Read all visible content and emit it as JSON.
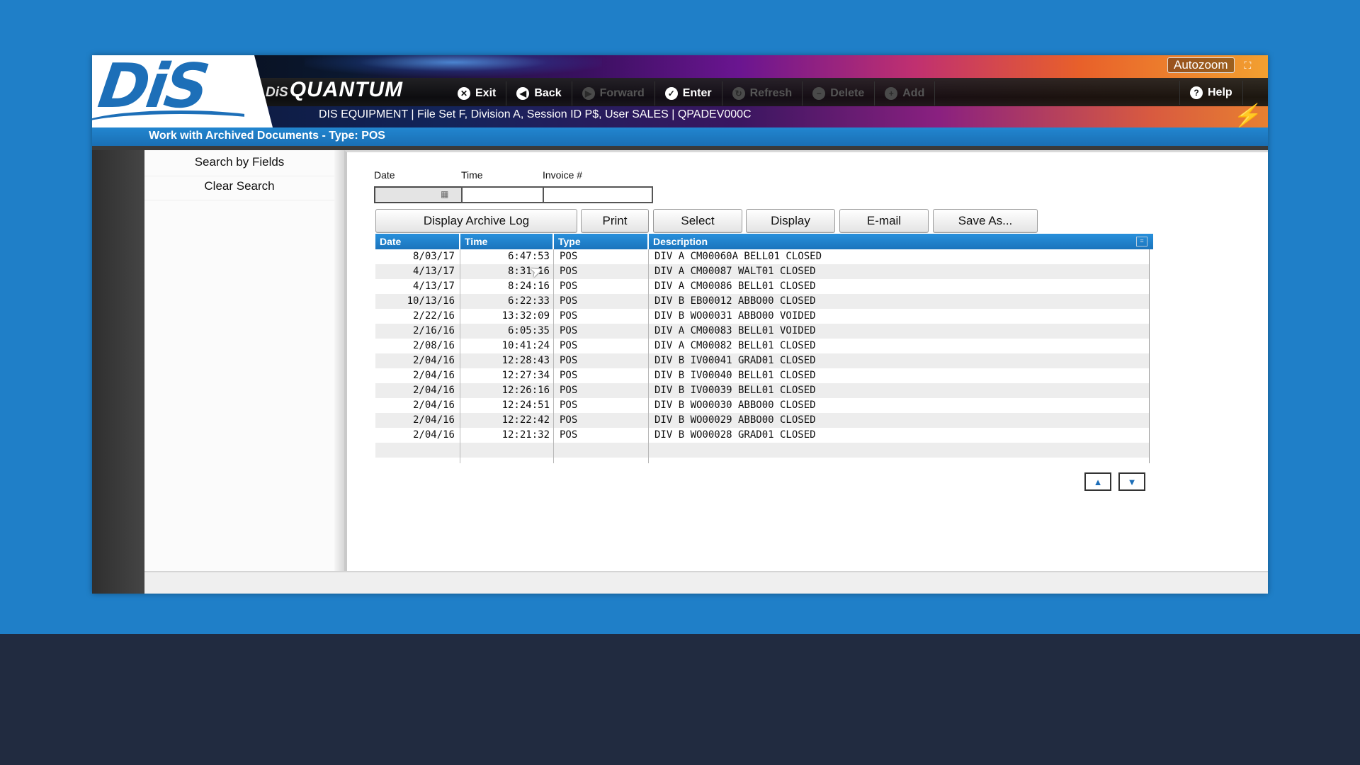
{
  "header": {
    "logo_text": "DiS",
    "brand_small": "DiS",
    "brand_big": "QUANTUM",
    "session_line": "DIS EQUIPMENT | File Set F, Division A, Session ID P$, User SALES | QPADEV000C",
    "autozoom_label": "Autozoom",
    "toolbar": [
      {
        "label": "Exit",
        "icon": "x-circle",
        "glyph": "✕",
        "enabled": true
      },
      {
        "label": "Back",
        "icon": "arrow-left-circle",
        "glyph": "◀",
        "enabled": true
      },
      {
        "label": "Forward",
        "icon": "arrow-right-circle",
        "glyph": "▶",
        "enabled": false
      },
      {
        "label": "Enter",
        "icon": "check-circle",
        "glyph": "✓",
        "enabled": true
      },
      {
        "label": "Refresh",
        "icon": "refresh-circle",
        "glyph": "↻",
        "enabled": false
      },
      {
        "label": "Delete",
        "icon": "minus-circle",
        "glyph": "−",
        "enabled": false
      },
      {
        "label": "Add",
        "icon": "plus-circle",
        "glyph": "+",
        "enabled": false
      }
    ],
    "help_label": "Help"
  },
  "subtitle": "Work with Archived Documents - Type: POS",
  "sidebar": {
    "items": [
      {
        "label": "Search by Fields"
      },
      {
        "label": "Clear Search"
      }
    ]
  },
  "search": {
    "date_label": "Date",
    "time_label": "Time",
    "invoice_label": "Invoice #",
    "date_value": "",
    "time_value": "",
    "invoice_value": ""
  },
  "actions": {
    "display_archive_log": "Display Archive Log",
    "print": "Print",
    "select": "Select",
    "display": "Display",
    "email": "E-mail",
    "save_as": "Save As..."
  },
  "grid": {
    "columns": [
      "Date",
      "Time",
      "Type",
      "Description"
    ],
    "rows": [
      {
        "date": "8/03/17",
        "time": "6:47:53",
        "type": "POS",
        "description": "DIV A CM00060A BELL01 CLOSED"
      },
      {
        "date": "4/13/17",
        "time": "8:31:16",
        "type": "POS",
        "description": "DIV A CM00087 WALT01 CLOSED"
      },
      {
        "date": "4/13/17",
        "time": "8:24:16",
        "type": "POS",
        "description": "DIV A CM00086 BELL01 CLOSED"
      },
      {
        "date": "10/13/16",
        "time": "6:22:33",
        "type": "POS",
        "description": "DIV B EB00012 ABBO00 CLOSED"
      },
      {
        "date": "2/22/16",
        "time": "13:32:09",
        "type": "POS",
        "description": "DIV B WO00031 ABBO00 VOIDED"
      },
      {
        "date": "2/16/16",
        "time": "6:05:35",
        "type": "POS",
        "description": "DIV A CM00083 BELL01 VOIDED"
      },
      {
        "date": "2/08/16",
        "time": "10:41:24",
        "type": "POS",
        "description": "DIV A CM00082 BELL01 CLOSED"
      },
      {
        "date": "2/04/16",
        "time": "12:28:43",
        "type": "POS",
        "description": "DIV B IV00041 GRAD01 CLOSED"
      },
      {
        "date": "2/04/16",
        "time": "12:27:34",
        "type": "POS",
        "description": "DIV B IV00040 BELL01 CLOSED"
      },
      {
        "date": "2/04/16",
        "time": "12:26:16",
        "type": "POS",
        "description": "DIV B IV00039 BELL01 CLOSED"
      },
      {
        "date": "2/04/16",
        "time": "12:24:51",
        "type": "POS",
        "description": "DIV B WO00030 ABBO00 CLOSED"
      },
      {
        "date": "2/04/16",
        "time": "12:22:42",
        "type": "POS",
        "description": "DIV B WO00029 ABBO00 CLOSED"
      },
      {
        "date": "2/04/16",
        "time": "12:21:32",
        "type": "POS",
        "description": "DIV B WO00028 GRAD01 CLOSED"
      }
    ]
  },
  "paging": {
    "up_icon": "page-up-arrow",
    "down_icon": "page-down-arrow"
  },
  "colors": {
    "desktop": "#1f7fc8",
    "bottom_band": "#212b40",
    "accent_blue": "#1d6fb8",
    "grid_header": "#2890dc",
    "bolt": "#ffd21a"
  }
}
